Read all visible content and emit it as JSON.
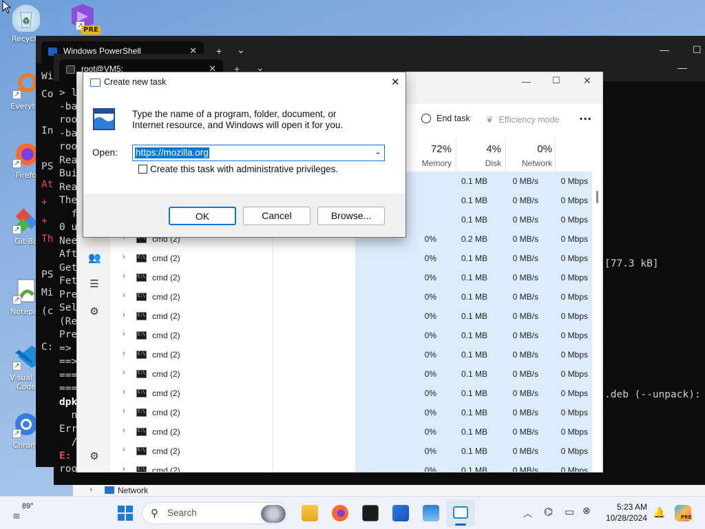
{
  "desktop": {
    "icons": [
      {
        "label": "Recycle"
      },
      {
        "label": "Everythi"
      },
      {
        "label": "Firefo"
      },
      {
        "label": "Git Ba"
      },
      {
        "label": "Notepac"
      },
      {
        "label": "Visual St"
      },
      {
        "label": "Code"
      },
      {
        "label": "Chromi"
      }
    ],
    "pre_badge": "PRE"
  },
  "powershell_window": {
    "tab_title": "Windows PowerShell",
    "new_tab": "+",
    "dropdown": "⌄",
    "lines": [
      "Wi",
      "Co",
      "",
      "In",
      "",
      "PS",
      "At",
      "+",
      "+",
      "Th",
      "",
      "PS",
      "Mi",
      "(c",
      "",
      "C:"
    ]
  },
  "ubuntu_window": {
    "tab_title": "root@VM5:",
    "new_tab": "+",
    "dropdown": "⌄",
    "lines": [
      "> l",
      "-ba",
      "roo",
      "-ba",
      "roo",
      "Rea",
      "Bui",
      "Rea",
      "The",
      "  f",
      "0 u",
      "Nee",
      "Aft",
      "Get",
      "Fet",
      "Pre",
      "Sel",
      "(Re",
      "Pre",
      "=> ",
      "==>",
      "===",
      "===",
      "dpk",
      "  ne",
      "Err",
      "  /v",
      "E: ",
      "roo"
    ],
    "right_text_1": "[77.3 kB]",
    "right_text_2": ".deb (--unpack):"
  },
  "task_manager": {
    "toolbar": {
      "end_task": "End task",
      "efficiency_mode": "Efficiency mode",
      "more": "···"
    },
    "columns": {
      "memory_pct": "72%",
      "memory_label": "Memory",
      "disk_pct": "4%",
      "disk_label": "Disk",
      "network_pct": "0%",
      "network_label": "Network"
    },
    "rows_top": [
      {
        "mem": "0.1 MB",
        "disk": "0 MB/s",
        "net": "0 Mbps"
      },
      {
        "mem": "0.1 MB",
        "disk": "0 MB/s",
        "net": "0 Mbps"
      },
      {
        "mem": "0.1 MB",
        "disk": "0 MB/s",
        "net": "0 Mbps"
      }
    ],
    "rows": [
      {
        "name": "cmd (2)",
        "cpu": "0%",
        "mem": "0.2 MB",
        "disk": "0 MB/s",
        "net": "0 Mbps"
      },
      {
        "name": "cmd (2)",
        "cpu": "0%",
        "mem": "0.1 MB",
        "disk": "0 MB/s",
        "net": "0 Mbps"
      },
      {
        "name": "cmd (2)",
        "cpu": "0%",
        "mem": "0.1 MB",
        "disk": "0 MB/s",
        "net": "0 Mbps"
      },
      {
        "name": "cmd (2)",
        "cpu": "0%",
        "mem": "0.1 MB",
        "disk": "0 MB/s",
        "net": "0 Mbps"
      },
      {
        "name": "cmd (2)",
        "cpu": "0%",
        "mem": "0.1 MB",
        "disk": "0 MB/s",
        "net": "0 Mbps"
      },
      {
        "name": "cmd (2)",
        "cpu": "0%",
        "mem": "0.1 MB",
        "disk": "0 MB/s",
        "net": "0 Mbps"
      },
      {
        "name": "cmd (2)",
        "cpu": "0%",
        "mem": "0.1 MB",
        "disk": "0 MB/s",
        "net": "0 Mbps"
      },
      {
        "name": "cmd (2)",
        "cpu": "0%",
        "mem": "0.1 MB",
        "disk": "0 MB/s",
        "net": "0 Mbps"
      },
      {
        "name": "cmd (2)",
        "cpu": "0%",
        "mem": "0.1 MB",
        "disk": "0 MB/s",
        "net": "0 Mbps"
      },
      {
        "name": "cmd (2)",
        "cpu": "0%",
        "mem": "0.1 MB",
        "disk": "0 MB/s",
        "net": "0 Mbps"
      },
      {
        "name": "cmd (2)",
        "cpu": "0%",
        "mem": "0.1 MB",
        "disk": "0 MB/s",
        "net": "0 Mbps"
      },
      {
        "name": "cmd (2)",
        "cpu": "0%",
        "mem": "0.1 MB",
        "disk": "0 MB/s",
        "net": "0 Mbps"
      },
      {
        "name": "cmd (2)",
        "cpu": "0%",
        "mem": "0.1 MB",
        "disk": "0 MB/s",
        "net": "0 Mbps"
      },
      {
        "name": "cmd (2)",
        "cpu": "0%",
        "mem": "0.1 MB",
        "disk": "0 MB/s",
        "net": "0 Mbps"
      }
    ]
  },
  "dialog": {
    "title": "Create new task",
    "description_line1": "Type the name of a program, folder, document, or",
    "description_line2": "Internet resource, and Windows will open it for you.",
    "open_label": "Open:",
    "open_value": "https://mozilla.org",
    "checkbox_label": "Create this task with administrative privileges.",
    "checkbox_checked": false,
    "ok": "OK",
    "cancel": "Cancel",
    "browse": "Browse..."
  },
  "explorer_strip": {
    "network_label": "Network"
  },
  "taskbar": {
    "weather_temp": "89°",
    "search_placeholder": "Search",
    "time": "5:23 AM",
    "date": "10/28/2024",
    "copilot_badge": "PRE"
  }
}
